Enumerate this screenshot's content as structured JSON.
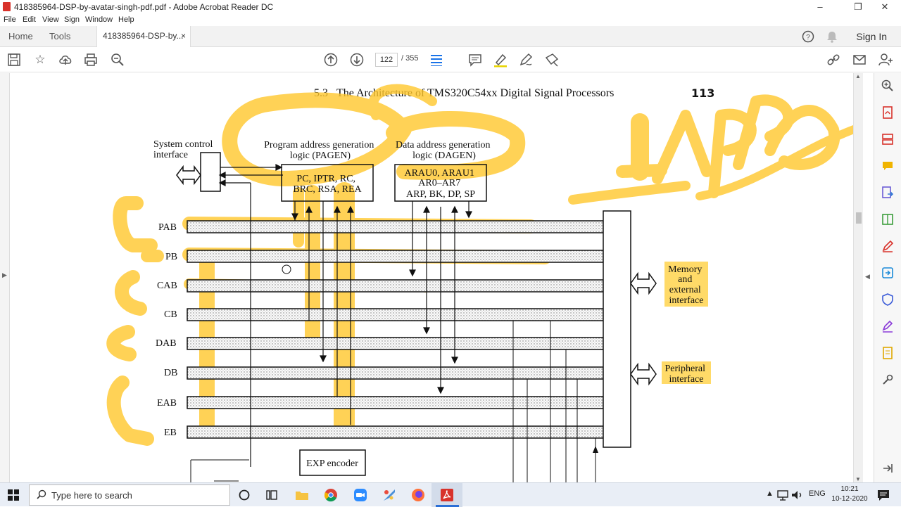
{
  "window": {
    "title": "418385964-DSP-by-avatar-singh-pdf.pdf - Adobe Acrobat Reader DC",
    "controls": [
      "–",
      "❐",
      "✕"
    ]
  },
  "menu": [
    "File",
    "Edit",
    "View",
    "Sign",
    "Window",
    "Help"
  ],
  "tabs": {
    "home": "Home",
    "tools": "Tools",
    "document": "418385964-DSP-by...",
    "close": "×"
  },
  "signin": "Sign In",
  "toolbar": {
    "page_current": "122",
    "page_separator": "/",
    "page_total": "355"
  },
  "page": {
    "header_section": "5.3",
    "header_title": "The Architecture of TMS320C54xx Digital Signal Processors",
    "page_number": "113"
  },
  "diagram": {
    "system_control": [
      "System control",
      "interface"
    ],
    "pagen_title": [
      "Program address generation",
      "logic (PAGEN)"
    ],
    "pagen_regs": [
      "PC, IPTR, RC,",
      "BRC, RSA, REA"
    ],
    "dagen_title": [
      "Data address generation",
      "logic (DAGEN)"
    ],
    "dagen_regs": [
      "ARAU0, ARAU1",
      "AR0–AR7",
      "ARP, BK, DP, SP"
    ],
    "buses": [
      "PAB",
      "PB",
      "CAB",
      "CB",
      "DAB",
      "DB",
      "EAB",
      "EB"
    ],
    "memory_interface": [
      "Memory",
      "and",
      "external",
      "interface"
    ],
    "peripheral_interface": [
      "Peripheral",
      "interface"
    ],
    "exp_encoder": "EXP encoder"
  },
  "taskbar": {
    "search_placeholder": "Type here to search",
    "language": "ENG",
    "time": "10:21",
    "date": "10-12-2020"
  },
  "colors": {
    "highlighter": "#ffc72c",
    "acrobat_red": "#d8322b",
    "chrome_bg": "#f2f2f2"
  }
}
